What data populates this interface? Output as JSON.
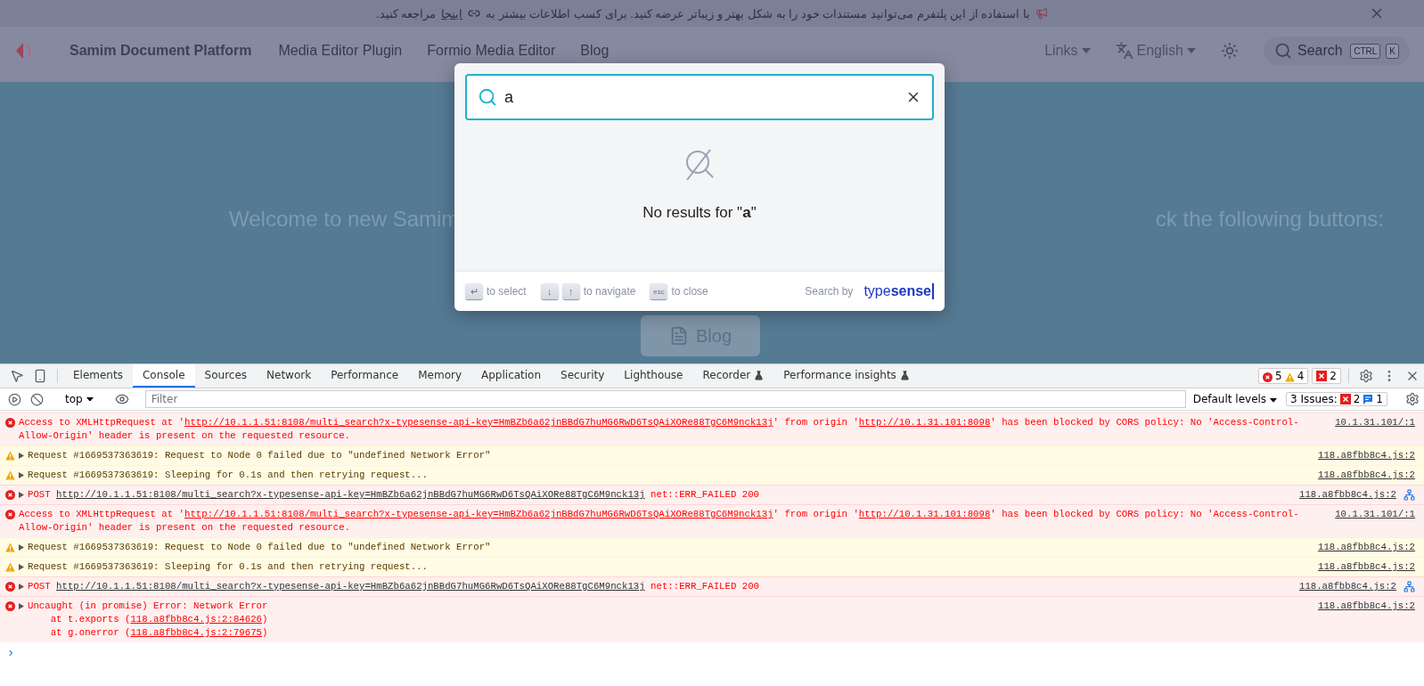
{
  "banner": {
    "text_before": "با استفاده از این پلتفرم می‌توانید مستندات خود را به شکل بهتر و زیباتر عرضه کنید. برای کسب اطلاعات بیشتر به",
    "link": "اینجا",
    "text_after": "مراجعه کنید."
  },
  "nav": {
    "brand": "Samim Document Platform",
    "links": [
      "Media Editor Plugin",
      "Formio Media Editor",
      "Blog"
    ],
    "menu": "Links",
    "language": "English",
    "search": {
      "placeholder": "Search",
      "keys": [
        "CTRL",
        "K"
      ]
    }
  },
  "hero": {
    "text_left": "Welcome to new Samim",
    "text_right": "ck the following buttons:",
    "button": "Blog"
  },
  "search_modal": {
    "query": "a",
    "empty_prefix": "No results for \"",
    "empty_query": "a",
    "empty_suffix": "\"",
    "hints": [
      {
        "keys": [
          "↵"
        ],
        "label": "to select"
      },
      {
        "keys": [
          "↓",
          "↑"
        ],
        "label": "to navigate"
      },
      {
        "keys": [
          "esc"
        ],
        "label": "to close"
      }
    ],
    "powered_by": "Search by",
    "brand_a": "type",
    "brand_b": "sense"
  },
  "devtools": {
    "tabs": [
      {
        "label": "Elements",
        "selected": false,
        "experimental": false
      },
      {
        "label": "Console",
        "selected": true,
        "experimental": false
      },
      {
        "label": "Sources",
        "selected": false,
        "experimental": false
      },
      {
        "label": "Network",
        "selected": false,
        "experimental": false
      },
      {
        "label": "Performance",
        "selected": false,
        "experimental": false
      },
      {
        "label": "Memory",
        "selected": false,
        "experimental": false
      },
      {
        "label": "Application",
        "selected": false,
        "experimental": false
      },
      {
        "label": "Security",
        "selected": false,
        "experimental": false
      },
      {
        "label": "Lighthouse",
        "selected": false,
        "experimental": false
      },
      {
        "label": "Recorder",
        "selected": false,
        "experimental": true
      },
      {
        "label": "Performance insights",
        "selected": false,
        "experimental": true
      }
    ],
    "counts": {
      "errors": "5",
      "warnings": "4",
      "issues": "2"
    },
    "toolbar": {
      "context": "top",
      "filter_placeholder": "Filter",
      "levels": "Default levels",
      "issues_label": "3 Issues:",
      "issues_errors": "2",
      "issues_info": "1"
    },
    "messages": [
      {
        "kind": "error",
        "expandable": false,
        "network": false,
        "source": "10.1.31.101/:1",
        "lines": [
          [
            {
              "text": "Access to XMLHttpRequest at '",
              "link": false
            },
            {
              "text": "http://10.1.1.51:8108/multi_search?x-typesense-api-key=HmBZb6a62jnBBdG7huMG6RwD6TsQAiXORe88TgC6M9nck13j",
              "link": true
            },
            {
              "text": "' from origin '",
              "link": false
            },
            {
              "text": "http://10.1.31.101:8098",
              "link": true
            },
            {
              "text": "' has been blocked by CORS policy: No 'Access-Control-Allow-Origin' header is present on the requested resource.",
              "link": false
            }
          ]
        ]
      },
      {
        "kind": "warning",
        "expandable": true,
        "network": false,
        "source": "118.a8fbb8c4.js:2",
        "lines": [
          [
            {
              "text": "Request #1669537363619: Request to Node 0 failed due to \"undefined Network Error\"",
              "link": false
            }
          ]
        ]
      },
      {
        "kind": "warning",
        "expandable": true,
        "network": false,
        "source": "118.a8fbb8c4.js:2",
        "lines": [
          [
            {
              "text": "Request #1669537363619: Sleeping for 0.1s and then retrying request...",
              "link": false
            }
          ]
        ]
      },
      {
        "kind": "error",
        "expandable": true,
        "network": true,
        "source": "118.a8fbb8c4.js:2",
        "lines": [
          [
            {
              "text": "POST ",
              "link": false
            },
            {
              "text": "http://10.1.1.51:8108/multi_search?x-typesense-api-key=HmBZb6a62jnBBdG7huMG6RwD6TsQAiXORe88TgC6M9nck13j",
              "link": true
            },
            {
              "text": " net::ERR_FAILED 200",
              "link": false
            }
          ]
        ]
      },
      {
        "kind": "error",
        "expandable": false,
        "network": false,
        "source": "10.1.31.101/:1",
        "lines": [
          [
            {
              "text": "Access to XMLHttpRequest at '",
              "link": false
            },
            {
              "text": "http://10.1.1.51:8108/multi_search?x-typesense-api-key=HmBZb6a62jnBBdG7huMG6RwD6TsQAiXORe88TgC6M9nck13j",
              "link": true
            },
            {
              "text": "' from origin '",
              "link": false
            },
            {
              "text": "http://10.1.31.101:8098",
              "link": true
            },
            {
              "text": "' has been blocked by CORS policy: No 'Access-Control-Allow-Origin' header is present on the requested resource.",
              "link": false
            }
          ]
        ]
      },
      {
        "kind": "warning",
        "expandable": true,
        "network": false,
        "source": "118.a8fbb8c4.js:2",
        "lines": [
          [
            {
              "text": "Request #1669537363619: Request to Node 0 failed due to \"undefined Network Error\"",
              "link": false
            }
          ]
        ]
      },
      {
        "kind": "warning",
        "expandable": true,
        "network": false,
        "source": "118.a8fbb8c4.js:2",
        "lines": [
          [
            {
              "text": "Request #1669537363619: Sleeping for 0.1s and then retrying request...",
              "link": false
            }
          ]
        ]
      },
      {
        "kind": "error",
        "expandable": true,
        "network": true,
        "source": "118.a8fbb8c4.js:2",
        "lines": [
          [
            {
              "text": "POST ",
              "link": false
            },
            {
              "text": "http://10.1.1.51:8108/multi_search?x-typesense-api-key=HmBZb6a62jnBBdG7huMG6RwD6TsQAiXORe88TgC6M9nck13j",
              "link": true
            },
            {
              "text": " net::ERR_FAILED 200",
              "link": false
            }
          ]
        ]
      },
      {
        "kind": "error",
        "expandable": true,
        "network": false,
        "source": "118.a8fbb8c4.js:2",
        "lines": [
          [
            {
              "text": "Uncaught (in promise) Error: Network Error",
              "link": false
            }
          ],
          [
            {
              "text": "    at t.exports (",
              "link": false
            },
            {
              "text": "118.a8fbb8c4.js:2:84626",
              "link": true
            },
            {
              "text": ")",
              "link": false
            }
          ],
          [
            {
              "text": "    at g.onerror (",
              "link": false
            },
            {
              "text": "118.a8fbb8c4.js:2:79675",
              "link": true
            },
            {
              "text": ")",
              "link": false
            }
          ]
        ]
      }
    ],
    "prompt": "›"
  }
}
